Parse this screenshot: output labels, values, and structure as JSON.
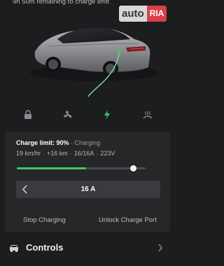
{
  "header": {
    "status_text": "9h 50m remaining to charge limit"
  },
  "watermark": {
    "auto": "auto",
    "ria": "RIA"
  },
  "tabs": [
    {
      "name": "lock",
      "icon": "lock-icon",
      "active": false
    },
    {
      "name": "climate",
      "icon": "fan-icon",
      "active": false
    },
    {
      "name": "charging",
      "icon": "lightning-icon",
      "active": true
    },
    {
      "name": "defrost",
      "icon": "defrost-icon",
      "active": false
    }
  ],
  "charging": {
    "limit_label": "Charge limit: 90%",
    "status": "Charging",
    "rate": "19 km/hr",
    "added": "+16 km",
    "current": "16/16A",
    "voltage": "223V",
    "slider_fill_fraction": 0.54,
    "limit_fraction": 0.9,
    "amps": "16 A",
    "stop_button": "Stop Charging",
    "unlock_button": "Unlock Charge Port"
  },
  "controls": {
    "label": "Controls"
  },
  "colors": {
    "accent_green": "#3fc766",
    "background": "#1c1d1f",
    "panel": "#262729"
  }
}
